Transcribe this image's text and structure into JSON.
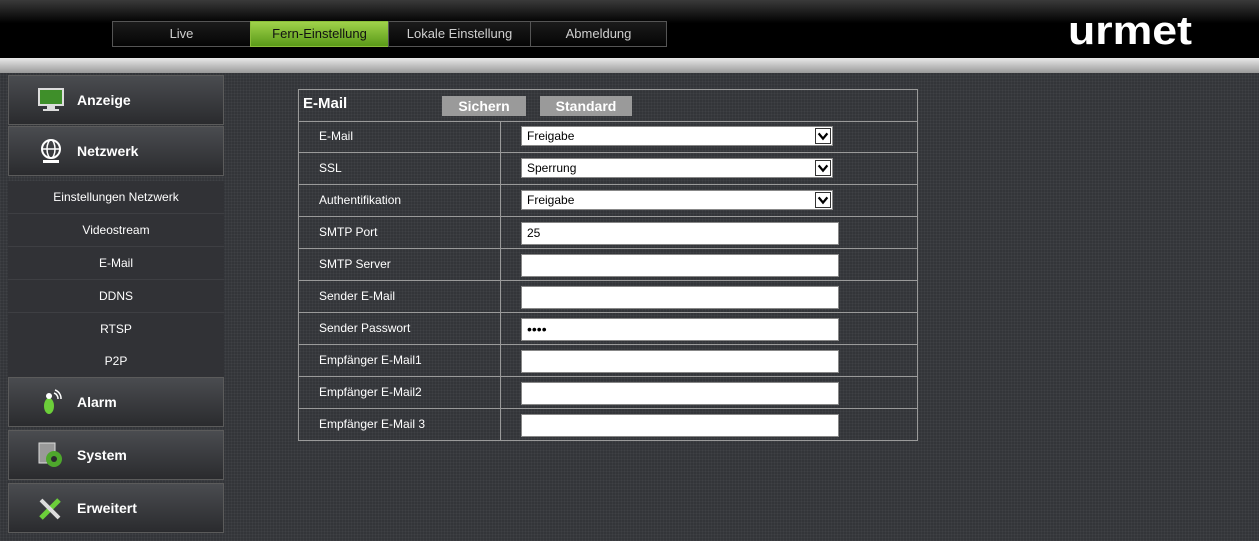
{
  "nav": {
    "tabs": [
      {
        "label": "Live"
      },
      {
        "label": "Fern-Einstellung"
      },
      {
        "label": "Lokale Einstellung"
      },
      {
        "label": "Abmeldung"
      }
    ],
    "active_tab": "Fern-Einstellung"
  },
  "logo": {
    "text": "urmet"
  },
  "sidebar": {
    "menu": [
      {
        "label": "Anzeige",
        "icon": "monitor-icon"
      },
      {
        "label": "Netzwerk",
        "icon": "network-globe-icon"
      },
      {
        "label": "Alarm",
        "icon": "alarm-icon"
      },
      {
        "label": "System",
        "icon": "system-gear-icon"
      },
      {
        "label": "Erweitert",
        "icon": "tools-icon"
      }
    ],
    "network_submenu": [
      {
        "label": "Einstellungen Netzwerk"
      },
      {
        "label": "Videostream"
      },
      {
        "label": "E-Mail"
      },
      {
        "label": "DDNS"
      },
      {
        "label": "RTSP"
      },
      {
        "label": "P2P"
      }
    ]
  },
  "panel": {
    "title": "E-Mail",
    "save_label": "Sichern",
    "default_label": "Standard",
    "rows": [
      {
        "label": "E-Mail",
        "type": "select",
        "value": "Freigabe"
      },
      {
        "label": "SSL",
        "type": "select",
        "value": "Sperrung"
      },
      {
        "label": "Authentifikation",
        "type": "select",
        "value": "Freigabe"
      },
      {
        "label": "SMTP Port",
        "type": "text",
        "value": "25"
      },
      {
        "label": "SMTP Server",
        "type": "text",
        "value": ""
      },
      {
        "label": "Sender E-Mail",
        "type": "text",
        "value": ""
      },
      {
        "label": "Sender Passwort",
        "type": "password",
        "value": "••••"
      },
      {
        "label": "Empfänger E-Mail1",
        "type": "text",
        "value": ""
      },
      {
        "label": "Empfänger E-Mail2",
        "type": "text",
        "value": ""
      },
      {
        "label": "Empfänger E-Mail 3",
        "type": "text",
        "value": ""
      }
    ]
  },
  "colors": {
    "active_tab": "#7cb82f",
    "background": "#333539",
    "button_grey": "#9a9a9a"
  }
}
